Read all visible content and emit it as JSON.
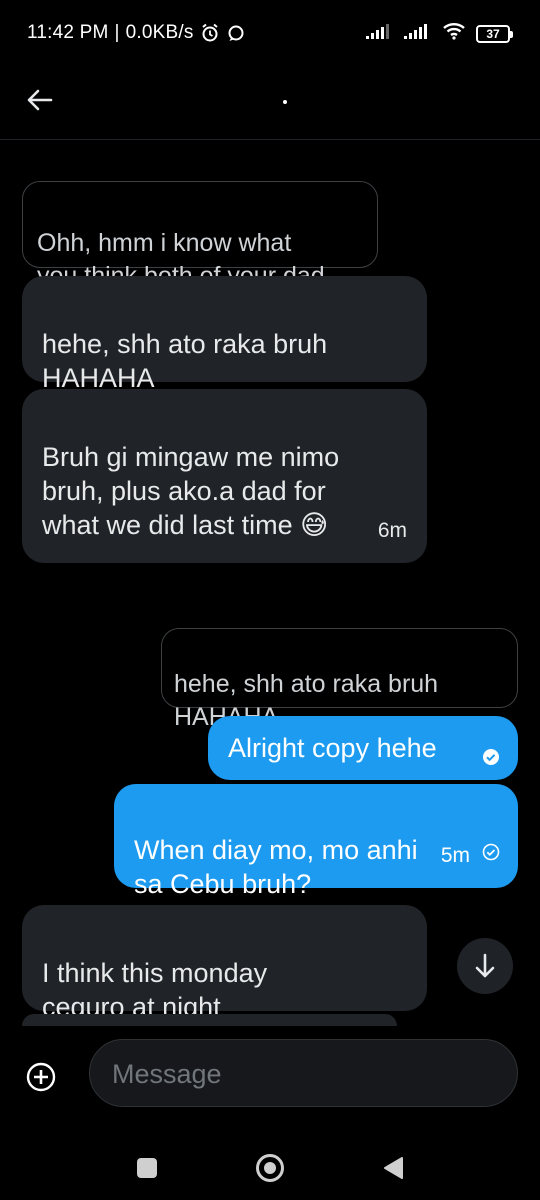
{
  "status_bar": {
    "time": "11:42 PM",
    "separator": "|",
    "speed": "0.0KB/s",
    "battery": "37"
  },
  "header": {
    "back_icon": "arrow-left-icon"
  },
  "messages": [
    {
      "type": "quote",
      "side": "received",
      "text": "Ohh, hmm i know what\nyou think both of your dad"
    },
    {
      "type": "message",
      "side": "received",
      "text": "hehe, shh ato raka bruh\nHAHAHA"
    },
    {
      "type": "message",
      "side": "received",
      "text": "Bruh gi mingaw me nimo\nbruh, plus ako.a dad for\nwhat we did last time 😅",
      "time": "6m"
    },
    {
      "type": "quote",
      "side": "sent",
      "text": "hehe, shh ato raka bruh\nHAHAHA"
    },
    {
      "type": "message",
      "side": "sent",
      "text": "Alright copy hehe",
      "status_icon": "read-check-icon"
    },
    {
      "type": "message",
      "side": "sent",
      "text": "When diay mo, mo anhi\nsa Cebu bruh?",
      "time": "5m",
      "status_icon": "sent-check-icon"
    },
    {
      "type": "message",
      "side": "received",
      "text": "I think this monday\nceguro at night"
    }
  ],
  "scroll_button": {
    "icon": "arrow-down-icon"
  },
  "composer": {
    "add_icon": "plus-circle-icon",
    "placeholder": "Message"
  },
  "colors": {
    "background": "#000000",
    "received_bubble": "#202327",
    "sent_bubble": "#1d9bf0",
    "text": "#e7e9ea",
    "placeholder": "#71767b"
  }
}
